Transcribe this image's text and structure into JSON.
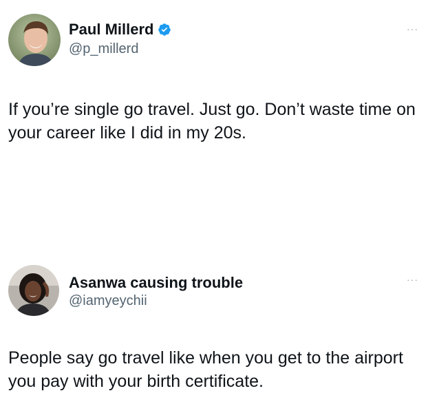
{
  "tweets": [
    {
      "display_name": "Paul Millerd",
      "handle": "@p_millerd",
      "verified": true,
      "text": "If you’re single go travel. Just go. Don’t waste time on your career like I did in my 20s.",
      "avatar_icon": "avatar-photo-man",
      "more_label": "···"
    },
    {
      "display_name": "Asanwa causing trouble",
      "handle": "@iamyeychii",
      "verified": false,
      "text": "People say go travel like when you get to the airport you pay with your birth certificate.",
      "avatar_icon": "avatar-photo-woman",
      "more_label": "···"
    }
  ],
  "colors": {
    "verified_blue": "#1d9bf0",
    "handle_gray": "#536471",
    "text_black": "#0f1419"
  }
}
